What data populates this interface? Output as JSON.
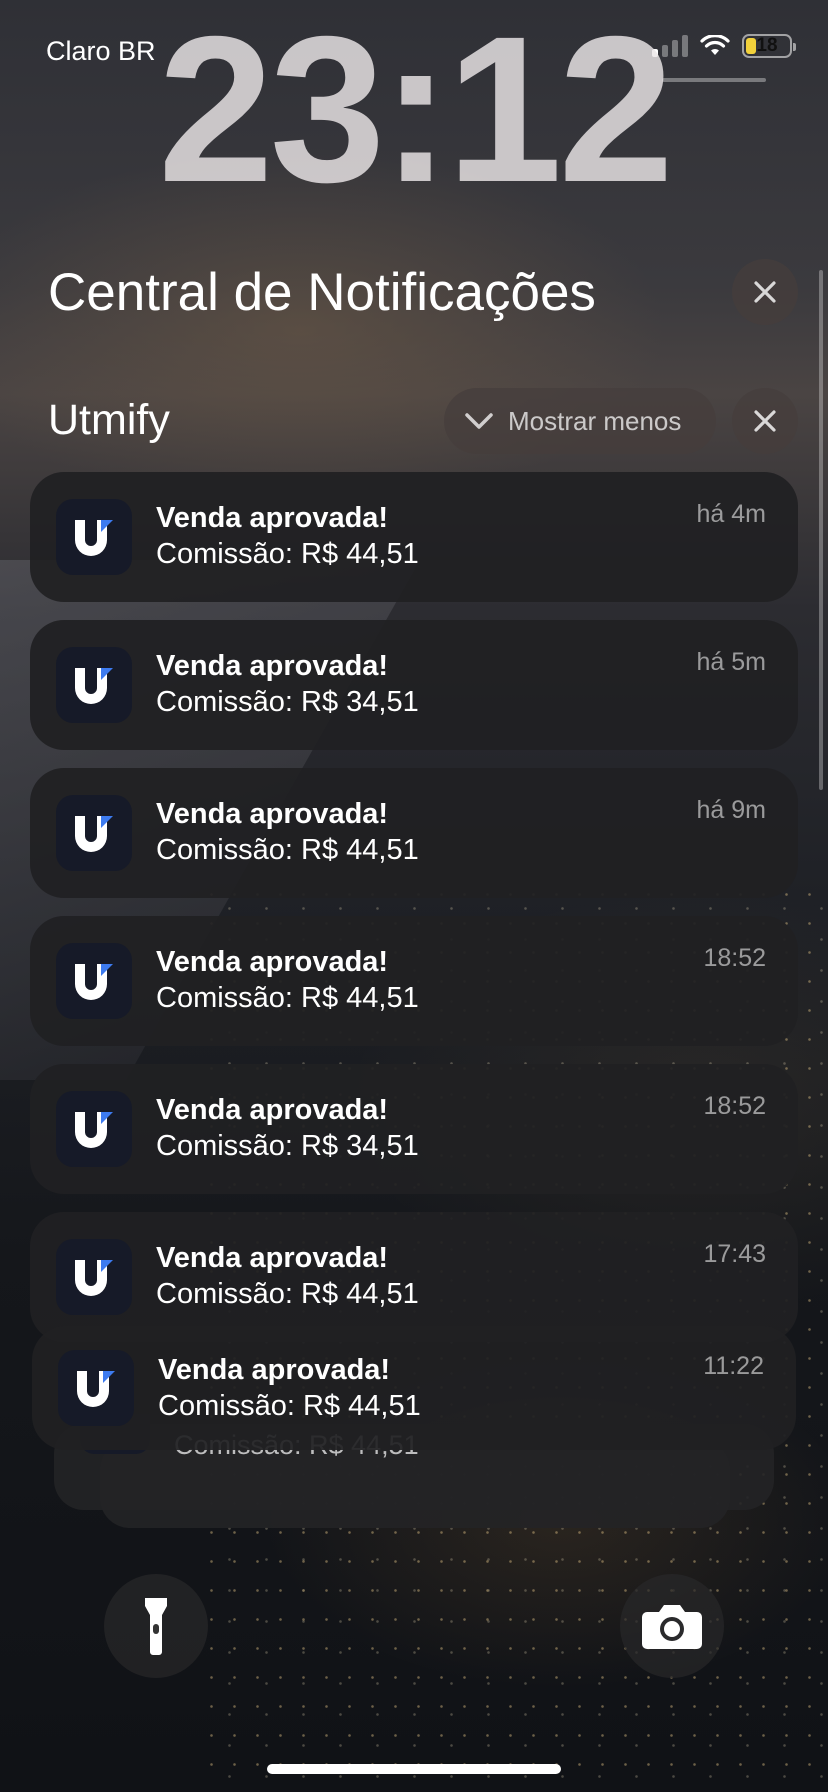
{
  "status_bar": {
    "carrier": "Claro BR",
    "battery_level": "18",
    "wifi_icon": "wifi-icon",
    "signal_icon": "cellular-signal-icon"
  },
  "lock_screen": {
    "time": "23:12"
  },
  "notification_center": {
    "title": "Central de Notificações",
    "clear_icon": "close-icon"
  },
  "group": {
    "app_name": "Utmify",
    "show_less_label": "Mostrar menos",
    "notifications": [
      {
        "title": "Venda aprovada!",
        "body": "Comissão: R$ 44,51",
        "time": "há 4m"
      },
      {
        "title": "Venda aprovada!",
        "body": "Comissão: R$ 34,51",
        "time": "há 5m"
      },
      {
        "title": "Venda aprovada!",
        "body": "Comissão: R$ 44,51",
        "time": "há 9m"
      },
      {
        "title": "Venda aprovada!",
        "body": "Comissão: R$ 44,51",
        "time": "18:52"
      },
      {
        "title": "Venda aprovada!",
        "body": "Comissão: R$ 34,51",
        "time": "18:52"
      },
      {
        "title": "Venda aprovada!",
        "body": "Comissão: R$ 44,51",
        "time": "17:43"
      },
      {
        "title": "Venda aprovada!",
        "body": "Comissão: R$ 44,51",
        "time": "11:22"
      }
    ],
    "stacked_partial_body": "Comissão: R$ 44,51"
  },
  "quick_actions": {
    "flashlight_icon": "flashlight-icon",
    "camera_icon": "camera-icon"
  },
  "colors": {
    "battery_fill": "#f2d13b",
    "app_icon_bg": "#161a28",
    "app_icon_accent": "#3d7bf0"
  }
}
